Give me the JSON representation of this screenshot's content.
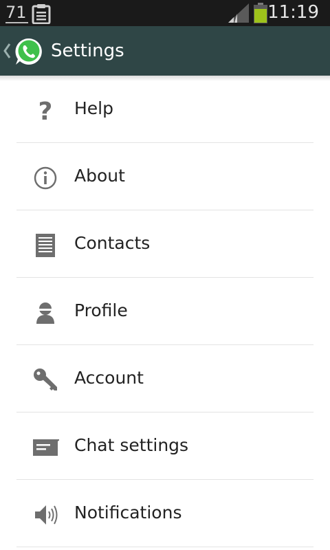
{
  "status_bar": {
    "notification_count": "71",
    "time": "11:19",
    "battery_color": "#9ec31b"
  },
  "action_bar": {
    "title": "Settings",
    "background_color": "#2f4646",
    "logo_icon": "whatsapp-logo-icon"
  },
  "settings": {
    "items": [
      {
        "label": "Help",
        "icon": "help-icon"
      },
      {
        "label": "About",
        "icon": "info-icon"
      },
      {
        "label": "Contacts",
        "icon": "contacts-icon"
      },
      {
        "label": "Profile",
        "icon": "profile-icon"
      },
      {
        "label": "Account",
        "icon": "key-icon"
      },
      {
        "label": "Chat settings",
        "icon": "chat-icon"
      },
      {
        "label": "Notifications",
        "icon": "speaker-icon"
      }
    ]
  }
}
